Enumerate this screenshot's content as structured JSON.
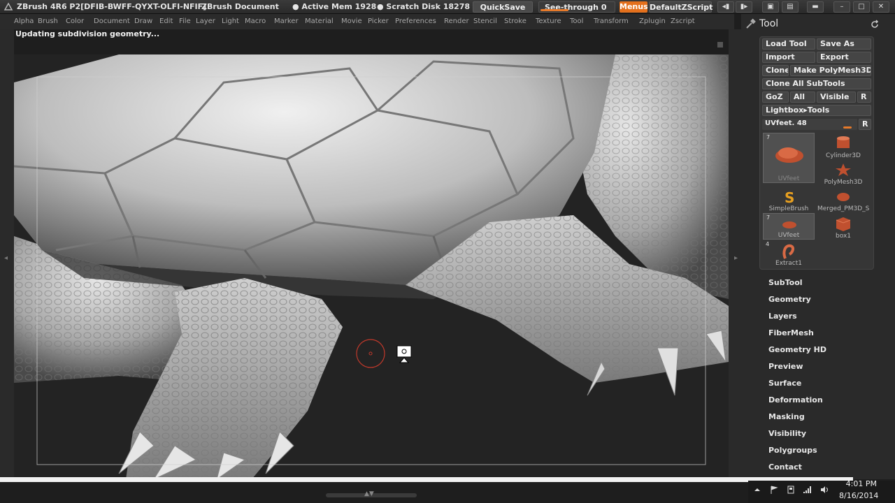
{
  "titlebar": {
    "title": "ZBrush 4R6 P2[DFIB-BWFF-QYXT-OLFI-NFIF]",
    "document": "ZBrush Document",
    "active_mem": "● Active Mem 1928",
    "scratch_disk": "● Scratch Disk 18278",
    "quicksave": "QuickSave",
    "see_through": "See-through  0",
    "menus": "Menus",
    "script": "DefaultZScript"
  },
  "menubar": {
    "items": [
      "Alpha",
      "Brush",
      "Color",
      "Document",
      "Draw",
      "Edit",
      "File",
      "Layer",
      "Light",
      "Macro",
      "Marker",
      "Material",
      "Movie",
      "Picker",
      "Preferences",
      "Render",
      "Stencil",
      "Stroke",
      "Texture",
      "Tool",
      "Transform",
      "Zplugin",
      "Zscript"
    ]
  },
  "status": {
    "message": "Updating subdivision geometry..."
  },
  "tool": {
    "title": "Tool",
    "buttons": {
      "load_tool": "Load Tool",
      "save_as": "Save As",
      "import": "Import",
      "export": "Export",
      "clone": "Clone",
      "make_polymesh": "Make PolyMesh3D",
      "clone_all": "Clone  All SubTools",
      "goz": "GoZ",
      "all": "All",
      "visible": "Visible",
      "r": "R",
      "lightbox": "Lightbox▸Tools"
    },
    "slider": {
      "label": "UVfeet. 48",
      "r": "R"
    },
    "thumbs": [
      {
        "count": "7",
        "label": "UVfeet"
      },
      {
        "count": "",
        "label": "Cylinder3D"
      },
      {
        "count": "",
        "label": "PolyMesh3D"
      },
      {
        "count": "",
        "label": "SimpleBrush"
      },
      {
        "count": "",
        "label": "Merged_PM3D_S"
      },
      {
        "count": "7",
        "label": "UVfeet"
      },
      {
        "count": "",
        "label": "box1"
      },
      {
        "count": "4",
        "label": "Extract1"
      }
    ],
    "subpalettes": [
      "SubTool",
      "Geometry",
      "Layers",
      "FiberMesh",
      "Geometry HD",
      "Preview",
      "Surface",
      "Deformation",
      "Masking",
      "Visibility",
      "Polygroups",
      "Contact"
    ]
  },
  "taskbar": {
    "time": "4:01 PM",
    "date": "8/16/2014"
  },
  "colors": {
    "accent": "#e4701c",
    "panel": "#363636",
    "background": "#1e1e1e"
  }
}
